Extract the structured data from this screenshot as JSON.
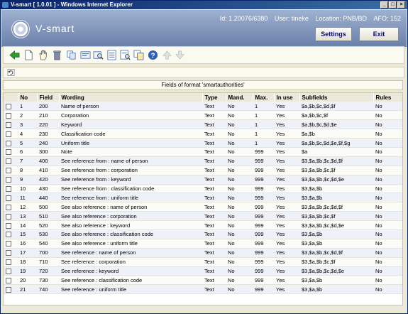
{
  "window": {
    "title": "V-smart [ 1.0.01 ] - Windows Internet Explorer"
  },
  "header": {
    "brand": "V-smart",
    "id_text": "Id: 1.20076/6380",
    "user_text": "User: tineke",
    "location_text": "Location: PNB/BD",
    "afo_text": "AFO: 152",
    "settings_label": "Settings",
    "exit_label": "Exit"
  },
  "toolbar_icons": [
    "back-arrow-icon",
    "new-document-icon",
    "select-hand-icon",
    "delete-trash-icon",
    "copy-icon",
    "view-record-icon",
    "search-zoom-icon",
    "edit-list-icon",
    "search-list-icon",
    "duplicate-icon",
    "help-icon",
    "move-up-icon",
    "move-down-icon"
  ],
  "caption": "Fields of format 'smartauthorities'",
  "table": {
    "headers": [
      "No",
      "Field",
      "Wording",
      "Type",
      "Mand.",
      "Max.",
      "In use",
      "Subfields",
      "Rules"
    ],
    "rows": [
      [
        "1",
        "200",
        "Name of person",
        "Text",
        "No",
        "1",
        "Yes",
        "$a,$b,$c,$d,$f",
        "No"
      ],
      [
        "2",
        "210",
        "Corporation",
        "Text",
        "No",
        "1",
        "Yes",
        "$a,$b,$c,$f",
        "No"
      ],
      [
        "3",
        "220",
        "Keyword",
        "Text",
        "No",
        "1",
        "Yes",
        "$a,$b,$c,$d,$e",
        "No"
      ],
      [
        "4",
        "230",
        "Classification code",
        "Text",
        "No",
        "1",
        "Yes",
        "$a,$b",
        "No"
      ],
      [
        "5",
        "240",
        "Uniform title",
        "Text",
        "No",
        "1",
        "Yes",
        "$a,$b,$c,$d,$e,$f,$g",
        "No"
      ],
      [
        "6",
        "300",
        "Note",
        "Text",
        "No",
        "999",
        "Yes",
        "$a",
        "No"
      ],
      [
        "7",
        "400",
        "See reference from : name of person",
        "Text",
        "No",
        "999",
        "Yes",
        "$3,$a,$b,$c,$d,$f",
        "No"
      ],
      [
        "8",
        "410",
        "See reference from : corporation",
        "Text",
        "No",
        "999",
        "Yes",
        "$3,$a,$b,$c,$f",
        "No"
      ],
      [
        "9",
        "420",
        "See reference from : keyword",
        "Text",
        "No",
        "999",
        "Yes",
        "$3,$a,$b,$c,$d,$e",
        "No"
      ],
      [
        "10",
        "430",
        "See reference from : classification code",
        "Text",
        "No",
        "999",
        "Yes",
        "$3,$a,$b",
        "No"
      ],
      [
        "11",
        "440",
        "See reference from : uniform title",
        "Text",
        "No",
        "999",
        "Yes",
        "$3,$a,$b",
        "No"
      ],
      [
        "12",
        "500",
        "See also reference : name of person",
        "Text",
        "No",
        "999",
        "Yes",
        "$3,$a,$b,$c,$d,$f",
        "No"
      ],
      [
        "13",
        "510",
        "See also reference : corporation",
        "Text",
        "No",
        "999",
        "Yes",
        "$3,$a,$b,$c,$f",
        "No"
      ],
      [
        "14",
        "520",
        "See also reference : keyword",
        "Text",
        "No",
        "999",
        "Yes",
        "$3,$a,$b,$c,$d,$e",
        "No"
      ],
      [
        "15",
        "530",
        "See also reference : classification code",
        "Text",
        "No",
        "999",
        "Yes",
        "$3,$a,$b",
        "No"
      ],
      [
        "16",
        "540",
        "See also reference : uniform title",
        "Text",
        "No",
        "999",
        "Yes",
        "$3,$a,$b",
        "No"
      ],
      [
        "17",
        "700",
        "See reference : name of person",
        "Text",
        "No",
        "999",
        "Yes",
        "$3,$a,$b,$c,$d,$f",
        "No"
      ],
      [
        "18",
        "710",
        "See reference : corporation",
        "Text",
        "No",
        "999",
        "Yes",
        "$3,$a,$b,$c,$f",
        "No"
      ],
      [
        "19",
        "720",
        "See reference : keyword",
        "Text",
        "No",
        "999",
        "Yes",
        "$3,$a,$b,$c,$d,$e",
        "No"
      ],
      [
        "20",
        "730",
        "See reference : classification code",
        "Text",
        "No",
        "999",
        "Yes",
        "$3,$a,$b",
        "No"
      ],
      [
        "21",
        "740",
        "See reference : uniform title",
        "Text",
        "No",
        "999",
        "Yes",
        "$3,$a,$b",
        "No"
      ]
    ]
  }
}
